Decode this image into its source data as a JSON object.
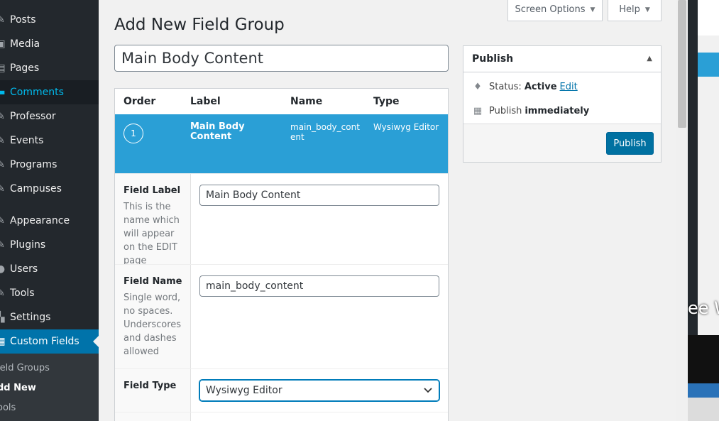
{
  "sidebar": {
    "items": [
      {
        "label": "Posts",
        "icon": "pushpin-icon"
      },
      {
        "label": "Media",
        "icon": "media-icon"
      },
      {
        "label": "Pages",
        "icon": "page-icon"
      },
      {
        "label": "Comments",
        "icon": "comment-icon"
      },
      {
        "label": "Professor",
        "icon": "post-type-icon"
      },
      {
        "label": "Events",
        "icon": "post-type-icon"
      },
      {
        "label": "Programs",
        "icon": "post-type-icon"
      },
      {
        "label": "Campuses",
        "icon": "post-type-icon"
      },
      {
        "label": "Appearance",
        "icon": "brush-icon"
      },
      {
        "label": "Plugins",
        "icon": "plugin-icon"
      },
      {
        "label": "Users",
        "icon": "user-icon"
      },
      {
        "label": "Tools",
        "icon": "wrench-icon"
      },
      {
        "label": "Settings",
        "icon": "settings-icon"
      },
      {
        "label": "Custom Fields",
        "icon": "custom-fields-icon"
      }
    ],
    "submenu": [
      "ield Groups",
      "dd New",
      "ools"
    ]
  },
  "screen_options": "Screen Options",
  "help": "Help",
  "page_title": "Add New Field Group",
  "group_title_value": "Main Body Content",
  "fields_table": {
    "headers": [
      "Order",
      "Label",
      "Name",
      "Type"
    ],
    "row": {
      "order": "1",
      "label": "Main Body Content",
      "name": "main_body_content",
      "type": "Wysiwyg Editor"
    }
  },
  "settings": {
    "field_label": {
      "label": "Field Label",
      "description": "This is the name which will appear on the EDIT page",
      "value": "Main Body Content"
    },
    "field_name": {
      "label": "Field Name",
      "description": "Single word, no spaces. Underscores and dashes allowed",
      "value": "main_body_content"
    },
    "field_type": {
      "label": "Field Type",
      "value": "Wysiwyg Editor"
    }
  },
  "publish": {
    "title": "Publish",
    "status_label": "Status:",
    "status_value": "Active",
    "edit_link": "Edit",
    "publish_label": "Publish",
    "publish_value": "immediately",
    "button": "Publish"
  },
  "overlay_text": "ee W",
  "colors": {
    "sidebar_bg": "#23282d",
    "accent": "#0073aa",
    "row_highlight": "#2a9fd6"
  }
}
